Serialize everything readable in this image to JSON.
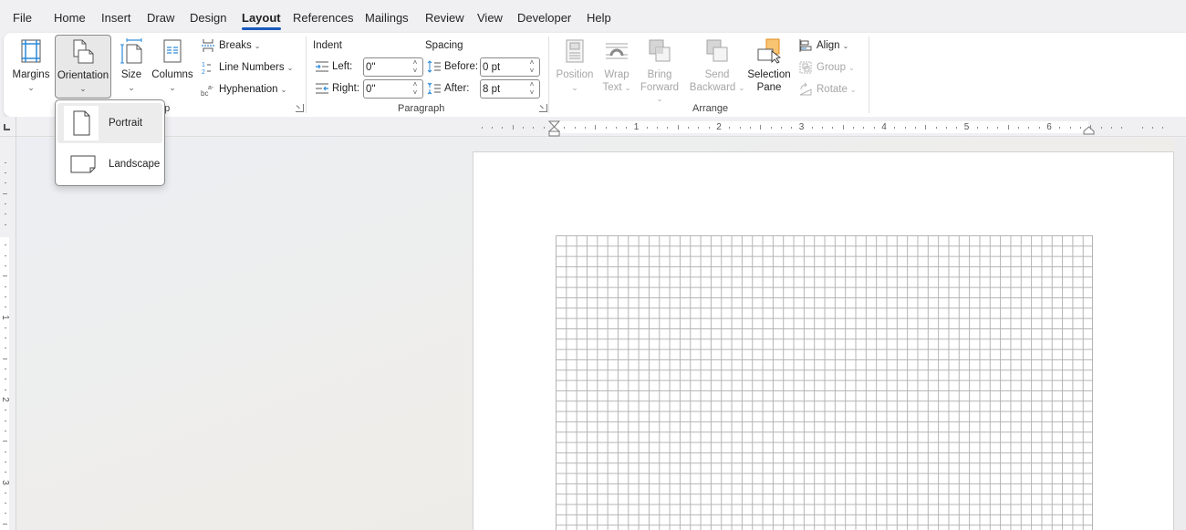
{
  "tabs": [
    {
      "label": "File",
      "active": false
    },
    {
      "label": "Home",
      "active": false
    },
    {
      "label": "Insert",
      "active": false
    },
    {
      "label": "Draw",
      "active": false
    },
    {
      "label": "Design",
      "active": false
    },
    {
      "label": "Layout",
      "active": true
    },
    {
      "label": "References",
      "active": false
    },
    {
      "label": "Mailings",
      "active": false
    },
    {
      "label": "Review",
      "active": false
    },
    {
      "label": "View",
      "active": false
    },
    {
      "label": "Developer",
      "active": false
    },
    {
      "label": "Help",
      "active": false
    }
  ],
  "page_setup": {
    "group_label": "Page Setup",
    "group_label_visible": "up",
    "margins": "Margins",
    "orientation": "Orientation",
    "size": "Size",
    "columns": "Columns",
    "breaks": "Breaks",
    "line_numbers": "Line Numbers",
    "hyphenation": "Hyphenation"
  },
  "paragraph": {
    "group_label": "Paragraph",
    "indent_heading": "Indent",
    "spacing_heading": "Spacing",
    "left_label": "Left:",
    "left_value": "0\"",
    "right_label": "Right:",
    "right_value": "0\"",
    "before_label": "Before:",
    "before_value": "0 pt",
    "after_label": "After:",
    "after_value": "8 pt"
  },
  "arrange": {
    "group_label": "Arrange",
    "position": "Position",
    "wrap_text_1": "Wrap",
    "wrap_text_2": "Text",
    "bring_forward_1": "Bring",
    "bring_forward_2": "Forward",
    "send_backward_1": "Send",
    "send_backward_2": "Backward",
    "selection_pane_1": "Selection",
    "selection_pane_2": "Pane",
    "align": "Align",
    "group": "Group",
    "rotate": "Rotate"
  },
  "orientation_menu": {
    "items": [
      {
        "label": "Portrait",
        "highlighted": true
      },
      {
        "label": "Landscape",
        "highlighted": false
      }
    ]
  },
  "ruler": {
    "horizontal_numbers": [
      "1",
      "2",
      "3",
      "4",
      "5",
      "6"
    ],
    "vertical_numbers": [
      "1",
      "2",
      "3"
    ]
  },
  "colors": {
    "accent": "#185abd",
    "icon_blue": "#2b88d8",
    "selection_pane_orange": "#f8c471"
  }
}
